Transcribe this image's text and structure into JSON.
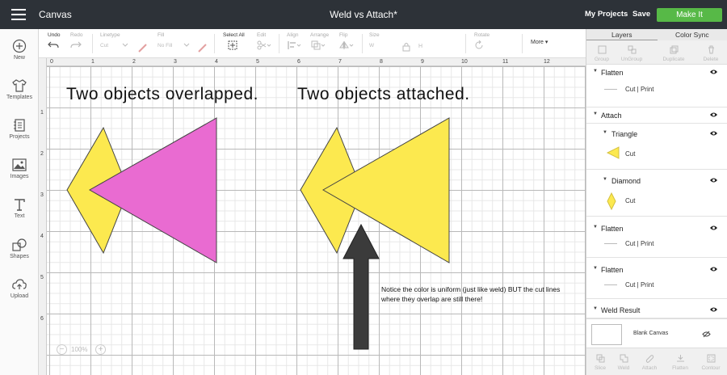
{
  "topbar": {
    "app_title": "Canvas",
    "doc_title": "Weld vs Attach*",
    "my_projects": "My Projects",
    "save": "Save",
    "make_it": "Make It"
  },
  "sidebar": {
    "items": [
      {
        "label": "New",
        "icon": "plus-circle-icon"
      },
      {
        "label": "Templates",
        "icon": "tshirt-icon"
      },
      {
        "label": "Projects",
        "icon": "projects-icon"
      },
      {
        "label": "Images",
        "icon": "image-icon"
      },
      {
        "label": "Text",
        "icon": "text-icon"
      },
      {
        "label": "Shapes",
        "icon": "shapes-icon"
      },
      {
        "label": "Upload",
        "icon": "upload-icon"
      }
    ]
  },
  "toolbar": {
    "undo": "Undo",
    "redo": "Redo",
    "linetype": "Linetype",
    "linetype_value": "Cut",
    "fill": "Fill",
    "fill_value": "No Fill",
    "select_all": "Select All",
    "edit": "Edit",
    "align": "Align",
    "arrange": "Arrange",
    "flip": "Flip",
    "size": "Size",
    "size_w": "W",
    "size_h": "H",
    "rotate": "Rotate",
    "more": "More ▾"
  },
  "canvas": {
    "ruler_top": [
      "0",
      "1",
      "2",
      "3",
      "4",
      "5",
      "6",
      "7",
      "8",
      "9",
      "10",
      "11",
      "12"
    ],
    "ruler_left": [
      "1",
      "2",
      "3",
      "4",
      "5",
      "6"
    ],
    "caption_left": "Two objects overlapped.",
    "caption_right": "Two objects attached.",
    "note": "Notice the color is uniform (just like weld) BUT the cut lines where they overlap are still there!",
    "zoom": "100%",
    "colors": {
      "yellow": "#fce94f",
      "pink": "#e96bd1",
      "arrow": "#3b3b3b"
    }
  },
  "panel": {
    "tabs": [
      "Layers",
      "Color Sync"
    ],
    "actions": [
      "Group",
      "UnGroup",
      "Duplicate",
      "Delete"
    ],
    "layers": {
      "flatten_1": {
        "name": "Flatten",
        "sub": "Cut  |  Print"
      },
      "attach": {
        "name": "Attach"
      },
      "triangle": {
        "name": "Triangle",
        "sub": "Cut"
      },
      "diamond": {
        "name": "Diamond",
        "sub": "Cut"
      },
      "flatten_2": {
        "name": "Flatten",
        "sub": "Cut  |  Print"
      },
      "flatten_3": {
        "name": "Flatten",
        "sub": "Cut  |  Print"
      },
      "weld_result": {
        "name": "Weld Result"
      }
    },
    "blank_canvas": "Blank Canvas",
    "footer": [
      "Slice",
      "Weld",
      "Attach",
      "Flatten",
      "Contour"
    ]
  }
}
